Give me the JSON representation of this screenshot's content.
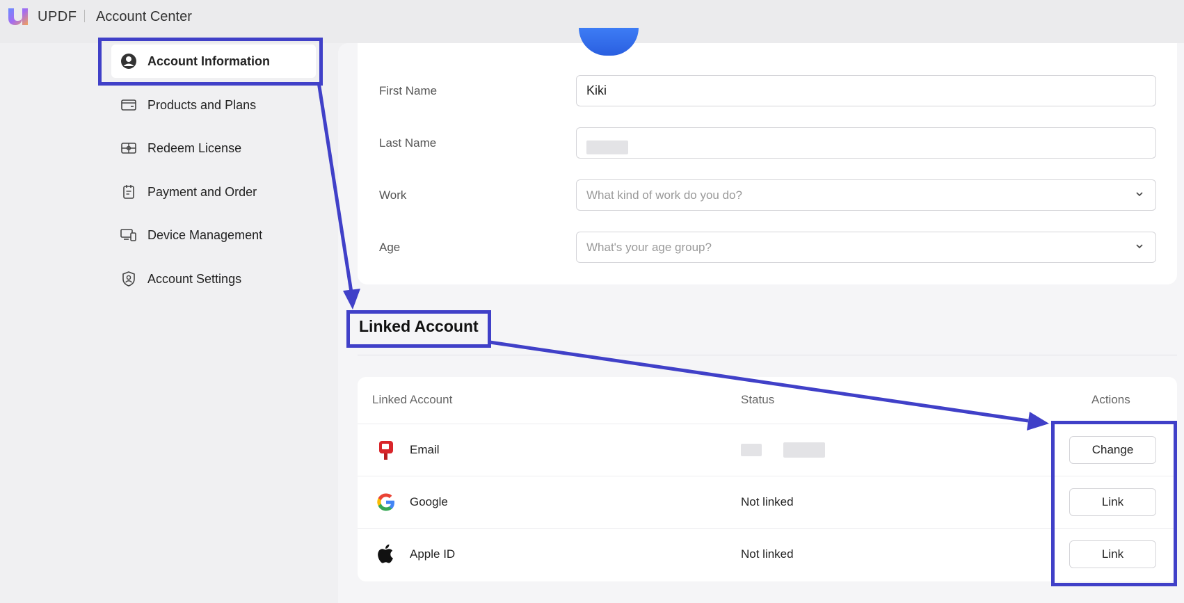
{
  "header": {
    "brand": "UPDF",
    "title": "Account Center"
  },
  "sidebar": {
    "items": [
      {
        "label": "Account Information",
        "icon": "user-circle-icon",
        "active": true
      },
      {
        "label": "Products and Plans",
        "icon": "card-icon"
      },
      {
        "label": "Redeem License",
        "icon": "gift-icon"
      },
      {
        "label": "Payment and Order",
        "icon": "receipt-icon"
      },
      {
        "label": "Device Management",
        "icon": "devices-icon"
      },
      {
        "label": "Account Settings",
        "icon": "shield-user-icon"
      }
    ]
  },
  "form": {
    "first_name_label": "First Name",
    "first_name_value": "Kiki",
    "last_name_label": "Last Name",
    "work_label": "Work",
    "work_placeholder": "What kind of work do you do?",
    "age_label": "Age",
    "age_placeholder": "What's your age group?"
  },
  "linked": {
    "section_title": "Linked Account",
    "columns": {
      "account": "Linked Account",
      "status": "Status",
      "actions": "Actions"
    },
    "rows": [
      {
        "name": "Email",
        "icon": "mailbox-icon",
        "status": "",
        "action": "Change"
      },
      {
        "name": "Google",
        "icon": "google-icon",
        "status": "Not linked",
        "action": "Link"
      },
      {
        "name": "Apple ID",
        "icon": "apple-icon",
        "status": "Not linked",
        "action": "Link"
      }
    ]
  },
  "colors": {
    "highlight": "#4040c8",
    "accent": "#2a5fe0"
  }
}
